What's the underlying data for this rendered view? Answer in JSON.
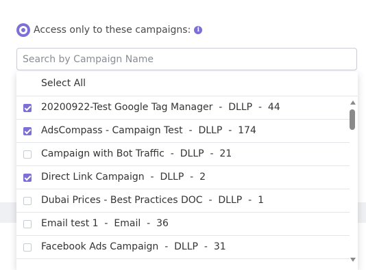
{
  "access": {
    "label": "Access only to these campaigns:",
    "selected": true
  },
  "search": {
    "placeholder": "Search by Campaign Name",
    "value": ""
  },
  "dropdown": {
    "select_all_label": "Select All",
    "options": [
      {
        "label": "20200922-Test Google Tag Manager  -  DLLP  -  44",
        "checked": true
      },
      {
        "label": "AdsCompass - Campaign Test  -  DLLP  -  174",
        "checked": true
      },
      {
        "label": "Campaign with Bot Traffic  -  DLLP  -  21",
        "checked": false
      },
      {
        "label": "Direct Link Campaign  -  DLLP  -  2",
        "checked": true
      },
      {
        "label": "Dubai Prices - Best Practices DOC  -  DLLP  -  1",
        "checked": false
      },
      {
        "label": "Email test 1  -  Email  -  36",
        "checked": false
      },
      {
        "label": "Facebook Ads Campaign  -  DLLP  -  31",
        "checked": false
      }
    ]
  },
  "colors": {
    "accent": "#7c6fd6",
    "border": "#c9ccd2",
    "divider": "#e3e5e8",
    "text": "#333333"
  },
  "icons": {
    "radio": "radio-selected-icon",
    "info": "info-icon",
    "check": "checkmark-icon"
  }
}
